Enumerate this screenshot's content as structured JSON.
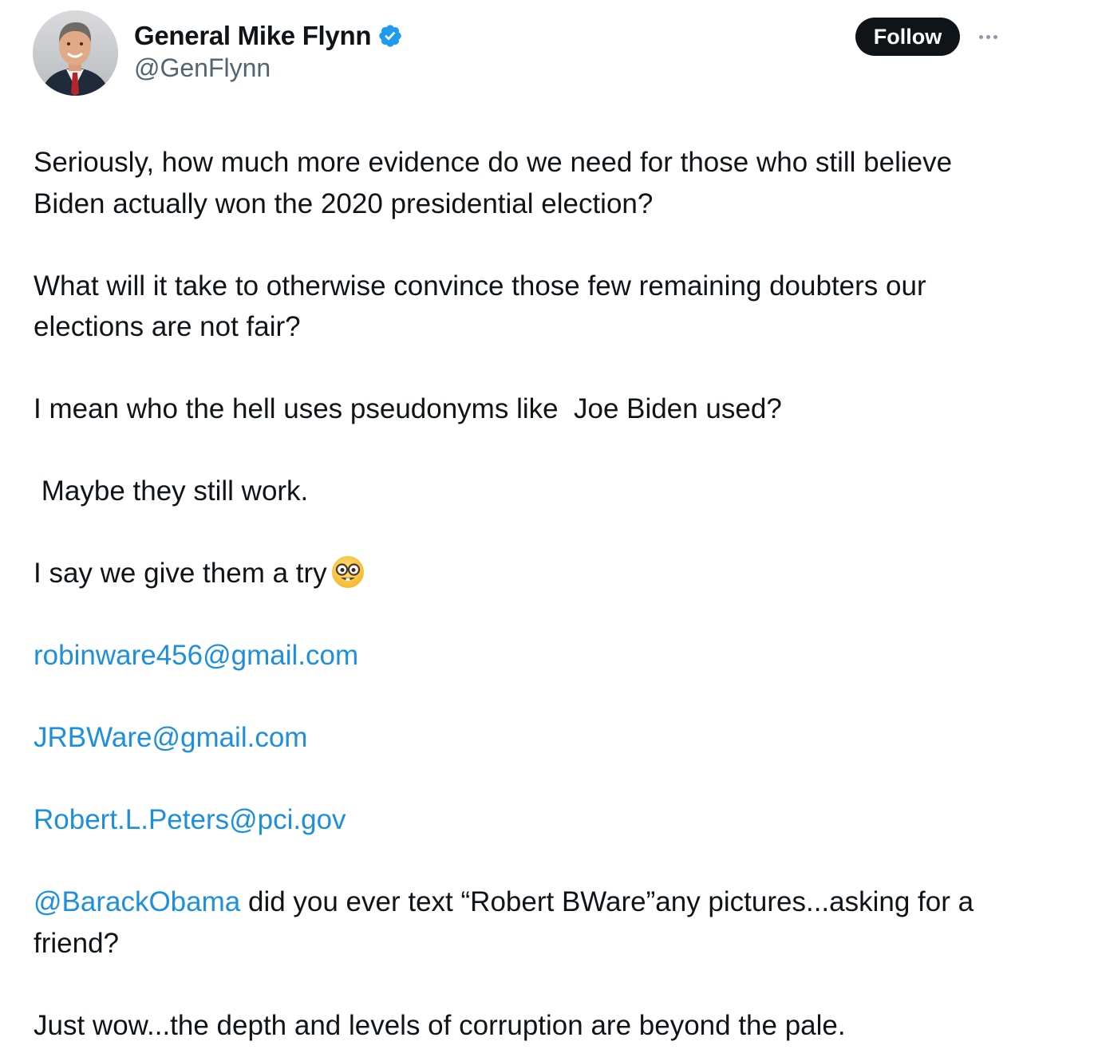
{
  "author": {
    "display_name": "General Mike Flynn",
    "handle": "@GenFlynn",
    "verified": true,
    "avatar": "profile-photo"
  },
  "actions": {
    "follow_label": "Follow",
    "more_icon": "more-horizontal-icon"
  },
  "tweet": {
    "p1": "Seriously, how much more evidence do we need for those who still believe Biden actually won the 2020 presidential election?",
    "p2": "What will it take to otherwise convince those few remaining doubters our elections are not fair?",
    "p3": "I mean who the hell uses pseudonyms like  Joe Biden used?",
    "p4": " Maybe they still work.",
    "p5": "I say we give them a try",
    "p5_emoji": "nerd-face-emoji",
    "email1": "robinware456@gmail.com",
    "email2": "JRBWare@gmail.com",
    "email3": "Robert.L.Peters@pci.gov",
    "mention": "@BarackObama",
    "p9_rest": " did you ever text “Robert BWare”any pictures...asking for a friend?",
    "p10": "Just wow...the depth and levels of corruption are beyond the pale."
  },
  "colors": {
    "text": "#0f1419",
    "secondary": "#536471",
    "link": "#1d8fdb",
    "verified": "#1d9bf0",
    "button_bg": "#0f1419"
  }
}
